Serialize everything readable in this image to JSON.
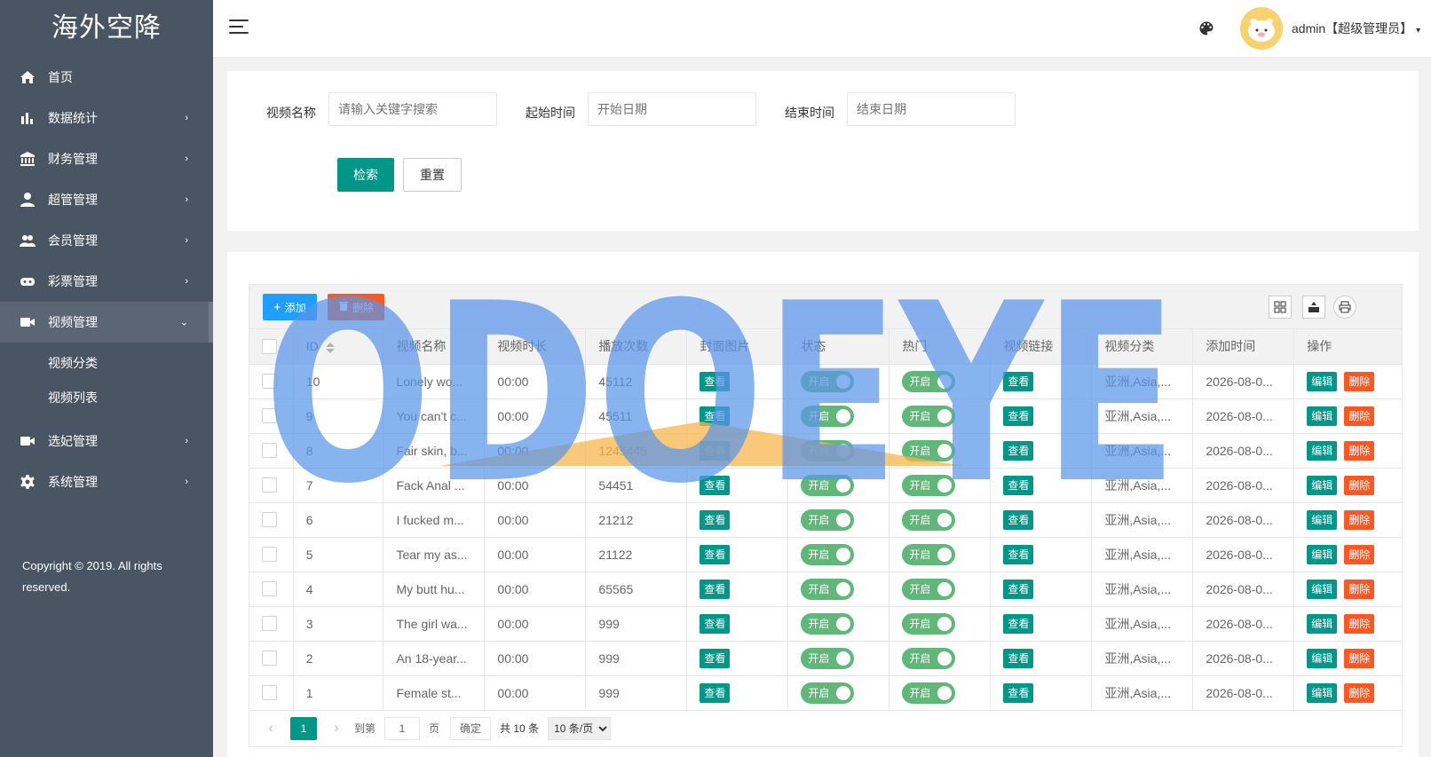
{
  "sidebar": {
    "logo": "海外空降",
    "items": [
      {
        "label": "首页",
        "icon": "home-icon",
        "arrow": ""
      },
      {
        "label": "数据统计",
        "icon": "bar-chart-icon",
        "arrow": "›"
      },
      {
        "label": "财务管理",
        "icon": "bank-icon",
        "arrow": "›"
      },
      {
        "label": "超管管理",
        "icon": "user-icon",
        "arrow": "›"
      },
      {
        "label": "会员管理",
        "icon": "users-icon",
        "arrow": "›"
      },
      {
        "label": "彩票管理",
        "icon": "gamepad-icon",
        "arrow": "›"
      },
      {
        "label": "视频管理",
        "icon": "video-camera-icon",
        "arrow": "⌄"
      },
      {
        "label": "选妃管理",
        "icon": "video-camera-icon",
        "arrow": "›"
      },
      {
        "label": "系统管理",
        "icon": "gear-icon",
        "arrow": "›"
      }
    ],
    "sub_items": [
      "视频分类",
      "视频列表"
    ],
    "copyright": "Copyright © 2019. All rights reserved."
  },
  "header": {
    "username": "admin【超级管理员】",
    "caret": "▾"
  },
  "search": {
    "video_name_label": "视频名称",
    "video_name_placeholder": "请输入关键字搜索",
    "start_label": "起始时间",
    "start_placeholder": "开始日期",
    "end_label": "结束时间",
    "end_placeholder": "结束日期",
    "search_button": "检索",
    "reset_button": "重置"
  },
  "toolbar": {
    "add_label": "添加",
    "delete_label": "删除"
  },
  "table": {
    "columns": [
      "ID",
      "视频名称",
      "视频时长",
      "播放次数",
      "封面图片",
      "状态",
      "热门",
      "视频链接",
      "视频分类",
      "添加时间",
      "操作"
    ],
    "rows": [
      {
        "id": "10",
        "name": "Lonely wo...",
        "duration": "00:00",
        "plays": "45112",
        "category": "亚洲,Asia,...",
        "added": "2026-08-0..."
      },
      {
        "id": "9",
        "name": "You can't c...",
        "duration": "00:00",
        "plays": "45511",
        "category": "亚洲,Asia,...",
        "added": "2026-08-0..."
      },
      {
        "id": "8",
        "name": "Fair skin, b...",
        "duration": "00:00",
        "plays": "1245445",
        "category": "亚洲,Asia,...",
        "added": "2026-08-0..."
      },
      {
        "id": "7",
        "name": "Fack Anal ...",
        "duration": "00:00",
        "plays": "54451",
        "category": "亚洲,Asia,...",
        "added": "2026-08-0..."
      },
      {
        "id": "6",
        "name": "I fucked m...",
        "duration": "00:00",
        "plays": "21212",
        "category": "亚洲,Asia,...",
        "added": "2026-08-0..."
      },
      {
        "id": "5",
        "name": "Tear my as...",
        "duration": "00:00",
        "plays": "21122",
        "category": "亚洲,Asia,...",
        "added": "2026-08-0..."
      },
      {
        "id": "4",
        "name": "My butt hu...",
        "duration": "00:00",
        "plays": "65565",
        "category": "亚洲,Asia,...",
        "added": "2026-08-0..."
      },
      {
        "id": "3",
        "name": "The girl wa...",
        "duration": "00:00",
        "plays": "999",
        "category": "亚洲,Asia,...",
        "added": "2026-08-0..."
      },
      {
        "id": "2",
        "name": "An 18-year...",
        "duration": "00:00",
        "plays": "999",
        "category": "亚洲,Asia,...",
        "added": "2026-08-0..."
      },
      {
        "id": "1",
        "name": "Female st...",
        "duration": "00:00",
        "plays": "999",
        "category": "亚洲,Asia,...",
        "added": "2026-08-0..."
      }
    ],
    "view_label": "查看",
    "switch_label": "开启",
    "edit_label": "编辑",
    "delete_label": "删除"
  },
  "pager": {
    "prev": "‹",
    "current": "1",
    "next": "›",
    "goto_label": "到第",
    "goto_value": "1",
    "page_unit": "页",
    "confirm": "确定",
    "total": "共 10 条",
    "limit": "10 条/页"
  },
  "watermark": {
    "text": "ODOEYE"
  },
  "colors": {
    "sidebar_bg": "#4a5564",
    "primary": "#009688",
    "danger": "#ff5722",
    "info": "#1e9fff",
    "switch_on": "#5fb878"
  }
}
